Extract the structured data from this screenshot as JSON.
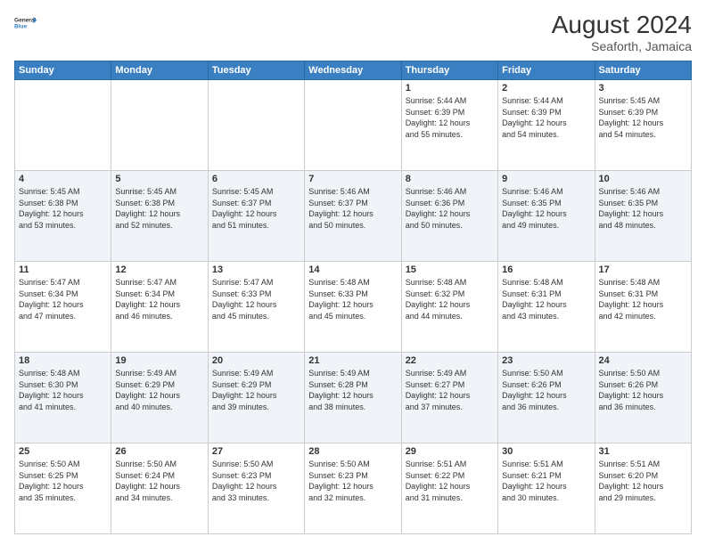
{
  "header": {
    "logo_line1": "General",
    "logo_line2": "Blue",
    "month_year": "August 2024",
    "location": "Seaforth, Jamaica"
  },
  "days_of_week": [
    "Sunday",
    "Monday",
    "Tuesday",
    "Wednesday",
    "Thursday",
    "Friday",
    "Saturday"
  ],
  "weeks": [
    [
      {
        "day": "",
        "info": ""
      },
      {
        "day": "",
        "info": ""
      },
      {
        "day": "",
        "info": ""
      },
      {
        "day": "",
        "info": ""
      },
      {
        "day": "1",
        "info": "Sunrise: 5:44 AM\nSunset: 6:39 PM\nDaylight: 12 hours\nand 55 minutes."
      },
      {
        "day": "2",
        "info": "Sunrise: 5:44 AM\nSunset: 6:39 PM\nDaylight: 12 hours\nand 54 minutes."
      },
      {
        "day": "3",
        "info": "Sunrise: 5:45 AM\nSunset: 6:39 PM\nDaylight: 12 hours\nand 54 minutes."
      }
    ],
    [
      {
        "day": "4",
        "info": "Sunrise: 5:45 AM\nSunset: 6:38 PM\nDaylight: 12 hours\nand 53 minutes."
      },
      {
        "day": "5",
        "info": "Sunrise: 5:45 AM\nSunset: 6:38 PM\nDaylight: 12 hours\nand 52 minutes."
      },
      {
        "day": "6",
        "info": "Sunrise: 5:45 AM\nSunset: 6:37 PM\nDaylight: 12 hours\nand 51 minutes."
      },
      {
        "day": "7",
        "info": "Sunrise: 5:46 AM\nSunset: 6:37 PM\nDaylight: 12 hours\nand 50 minutes."
      },
      {
        "day": "8",
        "info": "Sunrise: 5:46 AM\nSunset: 6:36 PM\nDaylight: 12 hours\nand 50 minutes."
      },
      {
        "day": "9",
        "info": "Sunrise: 5:46 AM\nSunset: 6:35 PM\nDaylight: 12 hours\nand 49 minutes."
      },
      {
        "day": "10",
        "info": "Sunrise: 5:46 AM\nSunset: 6:35 PM\nDaylight: 12 hours\nand 48 minutes."
      }
    ],
    [
      {
        "day": "11",
        "info": "Sunrise: 5:47 AM\nSunset: 6:34 PM\nDaylight: 12 hours\nand 47 minutes."
      },
      {
        "day": "12",
        "info": "Sunrise: 5:47 AM\nSunset: 6:34 PM\nDaylight: 12 hours\nand 46 minutes."
      },
      {
        "day": "13",
        "info": "Sunrise: 5:47 AM\nSunset: 6:33 PM\nDaylight: 12 hours\nand 45 minutes."
      },
      {
        "day": "14",
        "info": "Sunrise: 5:48 AM\nSunset: 6:33 PM\nDaylight: 12 hours\nand 45 minutes."
      },
      {
        "day": "15",
        "info": "Sunrise: 5:48 AM\nSunset: 6:32 PM\nDaylight: 12 hours\nand 44 minutes."
      },
      {
        "day": "16",
        "info": "Sunrise: 5:48 AM\nSunset: 6:31 PM\nDaylight: 12 hours\nand 43 minutes."
      },
      {
        "day": "17",
        "info": "Sunrise: 5:48 AM\nSunset: 6:31 PM\nDaylight: 12 hours\nand 42 minutes."
      }
    ],
    [
      {
        "day": "18",
        "info": "Sunrise: 5:48 AM\nSunset: 6:30 PM\nDaylight: 12 hours\nand 41 minutes."
      },
      {
        "day": "19",
        "info": "Sunrise: 5:49 AM\nSunset: 6:29 PM\nDaylight: 12 hours\nand 40 minutes."
      },
      {
        "day": "20",
        "info": "Sunrise: 5:49 AM\nSunset: 6:29 PM\nDaylight: 12 hours\nand 39 minutes."
      },
      {
        "day": "21",
        "info": "Sunrise: 5:49 AM\nSunset: 6:28 PM\nDaylight: 12 hours\nand 38 minutes."
      },
      {
        "day": "22",
        "info": "Sunrise: 5:49 AM\nSunset: 6:27 PM\nDaylight: 12 hours\nand 37 minutes."
      },
      {
        "day": "23",
        "info": "Sunrise: 5:50 AM\nSunset: 6:26 PM\nDaylight: 12 hours\nand 36 minutes."
      },
      {
        "day": "24",
        "info": "Sunrise: 5:50 AM\nSunset: 6:26 PM\nDaylight: 12 hours\nand 36 minutes."
      }
    ],
    [
      {
        "day": "25",
        "info": "Sunrise: 5:50 AM\nSunset: 6:25 PM\nDaylight: 12 hours\nand 35 minutes."
      },
      {
        "day": "26",
        "info": "Sunrise: 5:50 AM\nSunset: 6:24 PM\nDaylight: 12 hours\nand 34 minutes."
      },
      {
        "day": "27",
        "info": "Sunrise: 5:50 AM\nSunset: 6:23 PM\nDaylight: 12 hours\nand 33 minutes."
      },
      {
        "day": "28",
        "info": "Sunrise: 5:50 AM\nSunset: 6:23 PM\nDaylight: 12 hours\nand 32 minutes."
      },
      {
        "day": "29",
        "info": "Sunrise: 5:51 AM\nSunset: 6:22 PM\nDaylight: 12 hours\nand 31 minutes."
      },
      {
        "day": "30",
        "info": "Sunrise: 5:51 AM\nSunset: 6:21 PM\nDaylight: 12 hours\nand 30 minutes."
      },
      {
        "day": "31",
        "info": "Sunrise: 5:51 AM\nSunset: 6:20 PM\nDaylight: 12 hours\nand 29 minutes."
      }
    ]
  ]
}
